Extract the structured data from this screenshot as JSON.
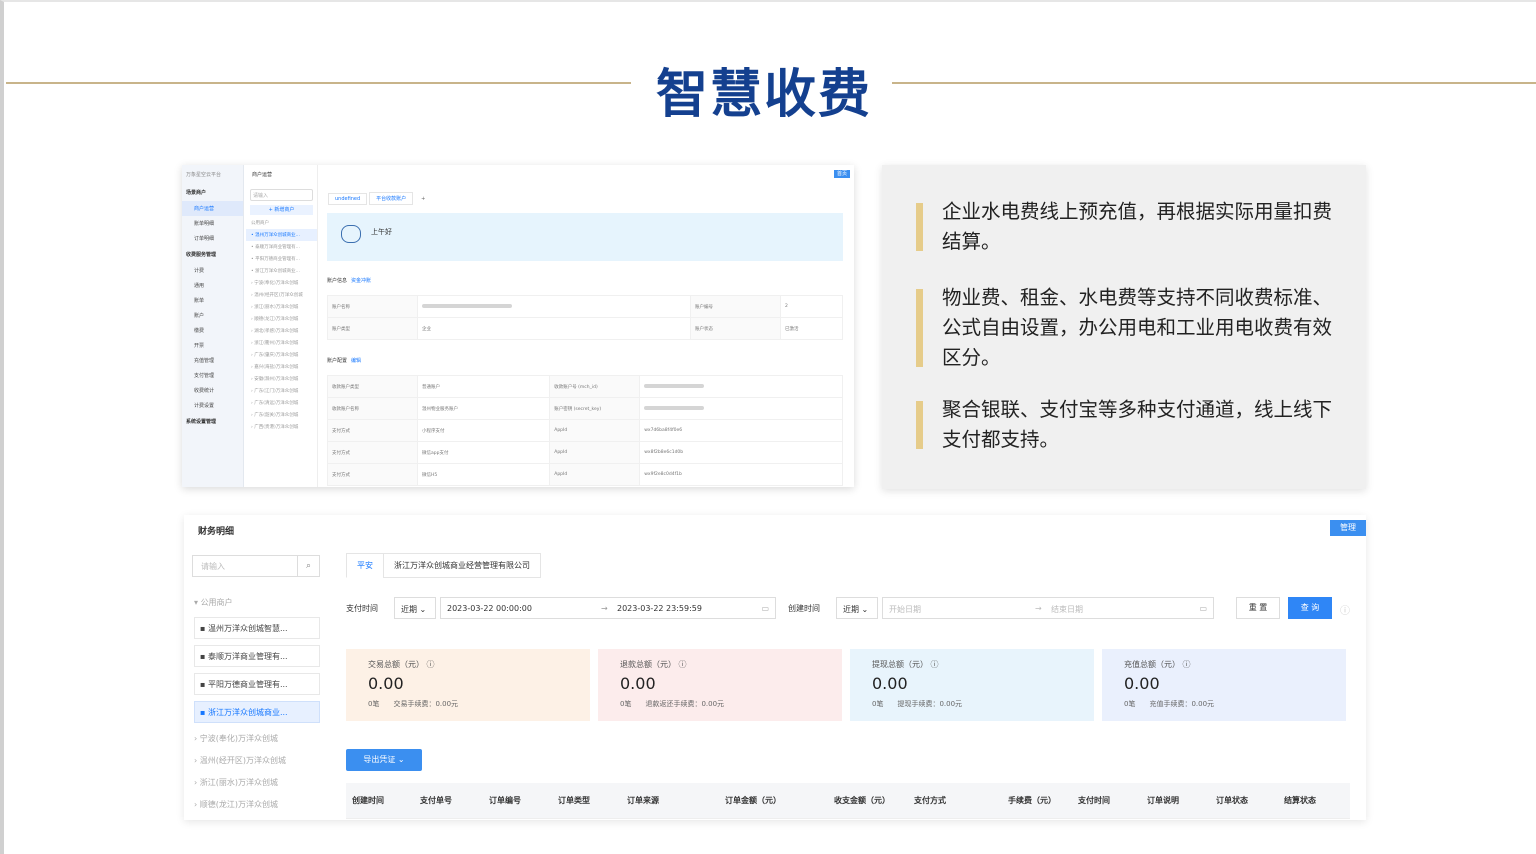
{
  "title": "智慧收费",
  "shot1": {
    "logo": "万象星空云平台",
    "breadcrumb": "商户运营",
    "badge": "首页",
    "sidebar": [
      {
        "label": "场景商户",
        "group": true
      },
      {
        "label": "商户运营",
        "active": true
      },
      {
        "label": "账单明细"
      },
      {
        "label": "订单明细"
      },
      {
        "label": "收费服务管理",
        "group": true
      },
      {
        "label": "计费"
      },
      {
        "label": "通用"
      },
      {
        "label": "账单"
      },
      {
        "label": "账户"
      },
      {
        "label": "缴费"
      },
      {
        "label": "开票"
      },
      {
        "label": "充值管理"
      },
      {
        "label": "支付管理"
      },
      {
        "label": "收费统计"
      },
      {
        "label": "计费设置"
      },
      {
        "label": "系统设置管理",
        "group": true
      }
    ],
    "tree": {
      "search": "请输入",
      "add_btn": "+ 新增商户",
      "group": "公用商户",
      "nodes": [
        "温州万洋众创城商业...",
        "泰顺万洋商业管理有...",
        "平阳万德商业管理有...",
        "浙江万洋众创城商业..."
      ],
      "active_index": 0,
      "subs": [
        "宁波(奉化)万洋众创城",
        "温州(经开区)万洋众创城",
        "浙江(丽水)万洋众创城",
        "顺德(龙江)万洋众创城",
        "湖北(孝感)万洋众创城",
        "浙江(衢州)万洋众创城",
        "广东(肇庆)万洋众创城",
        "嘉兴(海盐)万洋众创城",
        "安徽(滁州)万洋众创城",
        "广东(江门)万洋众创城",
        "广东(清远)万洋众创城",
        "广东(韶关)万洋众创城",
        "广西(贵港)万洋众创城"
      ]
    },
    "tabs": [
      "undefined",
      "平台收款账户"
    ],
    "greeting": "上午好",
    "sec1": {
      "label": "账户信息",
      "link": "资金冲账"
    },
    "rows1": [
      [
        "账户名称",
        "",
        "账户编号",
        "2"
      ],
      [
        "账户类型",
        "企业",
        "账户状态",
        "已激活"
      ]
    ],
    "sec2": {
      "label": "账户配置",
      "link": "编辑"
    },
    "rows2": [
      [
        "收款账户类型",
        "普通账户",
        "收款账户号 (mch_id)",
        ""
      ],
      [
        "收款账户名称",
        "温州物业服务账户",
        "账户密钥 (secret_key)",
        ""
      ],
      [
        "支付方式",
        "小程序支付",
        "AppId",
        "wx7d6ba8f4f0e6"
      ],
      [
        "支付方式",
        "微信app支付",
        "AppId",
        "wx8f2b8e6c1d0b"
      ],
      [
        "支付方式",
        "微信H5",
        "AppId",
        "wx9f2e8c0d4f1b"
      ]
    ]
  },
  "card": {
    "paragraphs": [
      "企业水电费线上预充值，再根据实际用量扣费结算。",
      "物业费、租金、水电费等支持不同收费标准、公式自由设置，办公用电和工业用电收费有效区分。",
      "聚合银联、支付宝等多种支付通道，线上线下支付都支持。"
    ],
    "accent": "#e6cc8a"
  },
  "shot2": {
    "title": "财务明细",
    "badge": "管理",
    "search_placeholder": "请输入",
    "tree_group": "公用商户",
    "nodes": [
      "温州万洋众创城智慧...",
      "泰顺万洋商业管理有...",
      "平阳万德商业管理有...",
      "浙江万洋众创城商业..."
    ],
    "active_index": 3,
    "subs": [
      "宁波(奉化)万洋众创城",
      "温州(经开区)万洋众创城",
      "浙江(丽水)万洋众创城",
      "顺德(龙江)万洋众创城"
    ],
    "tabs": [
      "平安",
      "浙江万洋众创城商业经营管理有限公司"
    ],
    "filter": {
      "pay_time_label": "支付时间",
      "pay_range": "近期",
      "start": "2023-03-22 00:00:00",
      "end": "2023-03-22 23:59:59",
      "create_time_label": "创建时间",
      "create_range": "近期",
      "start_ph": "开始日期",
      "end_ph": "结束日期",
      "reset": "重 置",
      "query": "查 询"
    },
    "stats": [
      {
        "label": "交易总额（元）",
        "value": "0.00",
        "count": "0笔",
        "detail": "交易手续费：0.00元",
        "bg": "#fdf1e6"
      },
      {
        "label": "退款总额（元）",
        "value": "0.00",
        "count": "0笔",
        "detail": "退款返还手续费：0.00元",
        "bg": "#fcecec"
      },
      {
        "label": "提现总额（元）",
        "value": "0.00",
        "count": "0笔",
        "detail": "提现手续费：0.00元",
        "bg": "#e8f4fc"
      },
      {
        "label": "充值总额（元）",
        "value": "0.00",
        "count": "0笔",
        "detail": "充值手续费：0.00元",
        "bg": "#eaf0fd"
      }
    ],
    "export": "导出凭证 ⌄",
    "columns": [
      "创建时间",
      "支付单号",
      "订单编号",
      "订单类型",
      "订单来源",
      "订单金额（元）",
      "收支金额（元）",
      "支付方式",
      "手续费（元）",
      "支付时间",
      "订单说明",
      "订单状态",
      "结算状态"
    ]
  }
}
